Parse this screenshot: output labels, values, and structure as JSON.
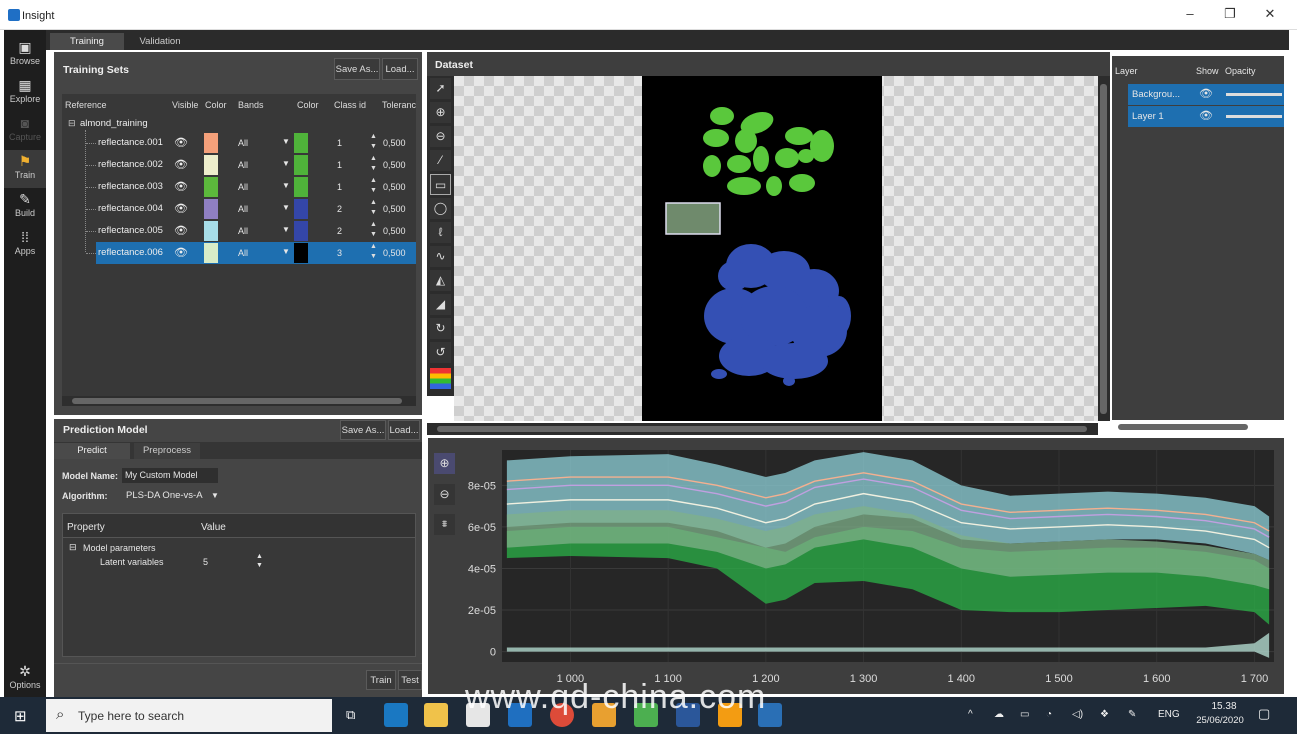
{
  "window": {
    "title": "Insight",
    "minimize": "–",
    "maximize": "❐",
    "close": "✕"
  },
  "nav": [
    {
      "label": "Browse",
      "icon": "browse-icon"
    },
    {
      "label": "Explore",
      "icon": "explore-icon"
    },
    {
      "label": "Capture",
      "icon": "camera-icon"
    },
    {
      "label": "Train",
      "icon": "train-icon"
    },
    {
      "label": "Build",
      "icon": "wrench-icon"
    },
    {
      "label": "Apps",
      "icon": "apps-grid-icon"
    },
    {
      "label": "Options",
      "icon": "gear-icon"
    }
  ],
  "tabs": [
    "Training",
    "Validation"
  ],
  "training_sets": {
    "title": "Training Sets",
    "save_as": "Save As...",
    "load": "Load...",
    "columns": [
      "Reference",
      "Visible",
      "Color",
      "Bands",
      "Color",
      "Class id",
      "Toleranc"
    ],
    "root": "almond_training",
    "rows": [
      {
        "name": "reflectance.001",
        "color": "#f4a07a",
        "bands": "All",
        "class_color": "#4fb33a",
        "class_id": "1",
        "tolerance": "0,500"
      },
      {
        "name": "reflectance.002",
        "color": "#eeeecc",
        "bands": "All",
        "class_color": "#4fb33a",
        "class_id": "1",
        "tolerance": "0,500"
      },
      {
        "name": "reflectance.003",
        "color": "#5cb83c",
        "bands": "All",
        "class_color": "#4fb33a",
        "class_id": "1",
        "tolerance": "0,500"
      },
      {
        "name": "reflectance.004",
        "color": "#8f7fc2",
        "bands": "All",
        "class_color": "#3446a8",
        "class_id": "2",
        "tolerance": "0,500"
      },
      {
        "name": "reflectance.005",
        "color": "#a7dde8",
        "bands": "All",
        "class_color": "#3446a8",
        "class_id": "2",
        "tolerance": "0,500"
      },
      {
        "name": "reflectance.006",
        "color": "#d8ecc8",
        "bands": "All",
        "class_color": "#000000",
        "class_id": "3",
        "tolerance": "0,500"
      }
    ]
  },
  "prediction_model": {
    "title": "Prediction Model",
    "save_as": "Save As...",
    "load": "Load...",
    "tabs": [
      "Predict",
      "Preprocess"
    ],
    "model_name_label": "Model Name:",
    "model_name": "My Custom Model",
    "algorithm_label": "Algorithm:",
    "algorithm": "PLS-DA One-vs-A",
    "property_header": "Property",
    "value_header": "Value",
    "group": "Model parameters",
    "param_name": "Latent variables",
    "param_value": "5",
    "train": "Train",
    "test": "Test"
  },
  "dataset": {
    "title": "Dataset"
  },
  "layers": {
    "headers": [
      "Layer",
      "Show",
      "Opacity"
    ],
    "items": [
      "Backgrou...",
      "Layer 1"
    ]
  },
  "chart_data": {
    "type": "area",
    "xlabel": "",
    "ylabel": "",
    "xlim": [
      930,
      1720
    ],
    "ylim": [
      -5e-06,
      9.7e-05
    ],
    "x_ticks": [
      "1 000",
      "1 100",
      "1 200",
      "1 300",
      "1 400",
      "1 500",
      "1 600",
      "1 700"
    ],
    "y_ticks": [
      "0",
      "2e-05",
      "4e-05",
      "6e-05",
      "8e-05"
    ],
    "x": [
      935,
      1000,
      1100,
      1150,
      1200,
      1220,
      1250,
      1300,
      1350,
      1400,
      1450,
      1500,
      1550,
      1600,
      1650,
      1700,
      1715
    ],
    "series": [
      {
        "color": "#2bb348",
        "lower": [
          4.5e-05,
          4.6e-05,
          4.5e-05,
          4e-05,
          2.3e-05,
          2.5e-05,
          3.3e-05,
          3.4e-05,
          3e-05,
          2e-05,
          1.9e-05,
          1.9e-05,
          2e-05,
          2.1e-05,
          2.2e-05,
          1.9e-05,
          1.3e-05
        ],
        "upper": [
          5.8e-05,
          6e-05,
          6e-05,
          5.5e-05,
          5e-05,
          4.8e-05,
          5.5e-05,
          6e-05,
          5.8e-05,
          5e-05,
          4.8e-05,
          4.9e-05,
          5e-05,
          5e-05,
          4.8e-05,
          4.4e-05,
          4e-05
        ]
      },
      {
        "color": "#8fd1d9",
        "lower": [
          6e-05,
          6.2e-05,
          6.2e-05,
          5.8e-05,
          5e-05,
          5.2e-05,
          6e-05,
          6.6e-05,
          6.4e-05,
          5.4e-05,
          5.2e-05,
          5.3e-05,
          5.4e-05,
          5.4e-05,
          5.2e-05,
          4.7e-05,
          4.4e-05
        ],
        "upper": [
          9.2e-05,
          9.4e-05,
          9.5e-05,
          9e-05,
          8.4e-05,
          8.6e-05,
          9.2e-05,
          9.6e-05,
          9.2e-05,
          8e-05,
          7.5e-05,
          7.6e-05,
          7.7e-05,
          7.6e-05,
          7.4e-05,
          7e-05,
          6.5e-05
        ]
      },
      {
        "color": "#7fb08a",
        "lower": [
          5e-05,
          5.2e-05,
          5.2e-05,
          4.8e-05,
          4e-05,
          4.2e-05,
          5e-05,
          5.4e-05,
          5e-05,
          4e-05,
          3.6e-05,
          3.7e-05,
          3.8e-05,
          3.8e-05,
          3.6e-05,
          3.2e-05,
          3e-05
        ],
        "upper": [
          6.6e-05,
          6.8e-05,
          6.8e-05,
          6.4e-05,
          5.8e-05,
          6e-05,
          6.6e-05,
          7e-05,
          6.6e-05,
          5.6e-05,
          5.2e-05,
          5.3e-05,
          5.4e-05,
          5.3e-05,
          5.1e-05,
          4.7e-05,
          4.4e-05
        ]
      },
      {
        "color": "#b9e4d8",
        "lower": [
          0.0,
          0.0,
          0.0,
          0.0,
          0.0,
          0.0,
          0.0,
          0.0,
          0.0,
          0.0,
          0.0,
          0.0,
          0.0,
          0.0,
          0.0,
          0.0,
          -3e-06
        ],
        "upper": [
          2e-06,
          2e-06,
          2e-06,
          2e-06,
          2e-06,
          2e-06,
          2e-06,
          2e-06,
          2e-06,
          2e-06,
          2e-06,
          2e-06,
          2e-06,
          2e-06,
          2e-06,
          4e-06,
          9e-06
        ]
      }
    ],
    "lines": [
      {
        "color": "#f0f0e0",
        "values": [
          7.1e-05,
          7.3e-05,
          7.3e-05,
          6.9e-05,
          6.2e-05,
          6.4e-05,
          7.1e-05,
          7.6e-05,
          7.2e-05,
          6.2e-05,
          5.9e-05,
          6e-05,
          6.1e-05,
          6e-05,
          5.8e-05,
          5.4e-05,
          5e-05
        ]
      },
      {
        "color": "#c0a0e0",
        "values": [
          7.8e-05,
          8e-05,
          8e-05,
          7.6e-05,
          7e-05,
          7.2e-05,
          7.9e-05,
          8.3e-05,
          7.9e-05,
          6.8e-05,
          6.4e-05,
          6.5e-05,
          6.6e-05,
          6.5e-05,
          6.3e-05,
          5.9e-05,
          5.5e-05
        ]
      },
      {
        "color": "#f4b090",
        "values": [
          8.2e-05,
          8.4e-05,
          8.4e-05,
          8e-05,
          7.4e-05,
          7.6e-05,
          8.2e-05,
          8.6e-05,
          8.2e-05,
          7.1e-05,
          6.7e-05,
          6.8e-05,
          6.9e-05,
          6.8e-05,
          6.6e-05,
          6.2e-05,
          5.8e-05
        ]
      }
    ]
  },
  "watermark": "www.qd-china.com",
  "taskbar": {
    "search": "Type here to search",
    "lang": "ENG",
    "time": "15.38",
    "date": "25/06/2020"
  }
}
